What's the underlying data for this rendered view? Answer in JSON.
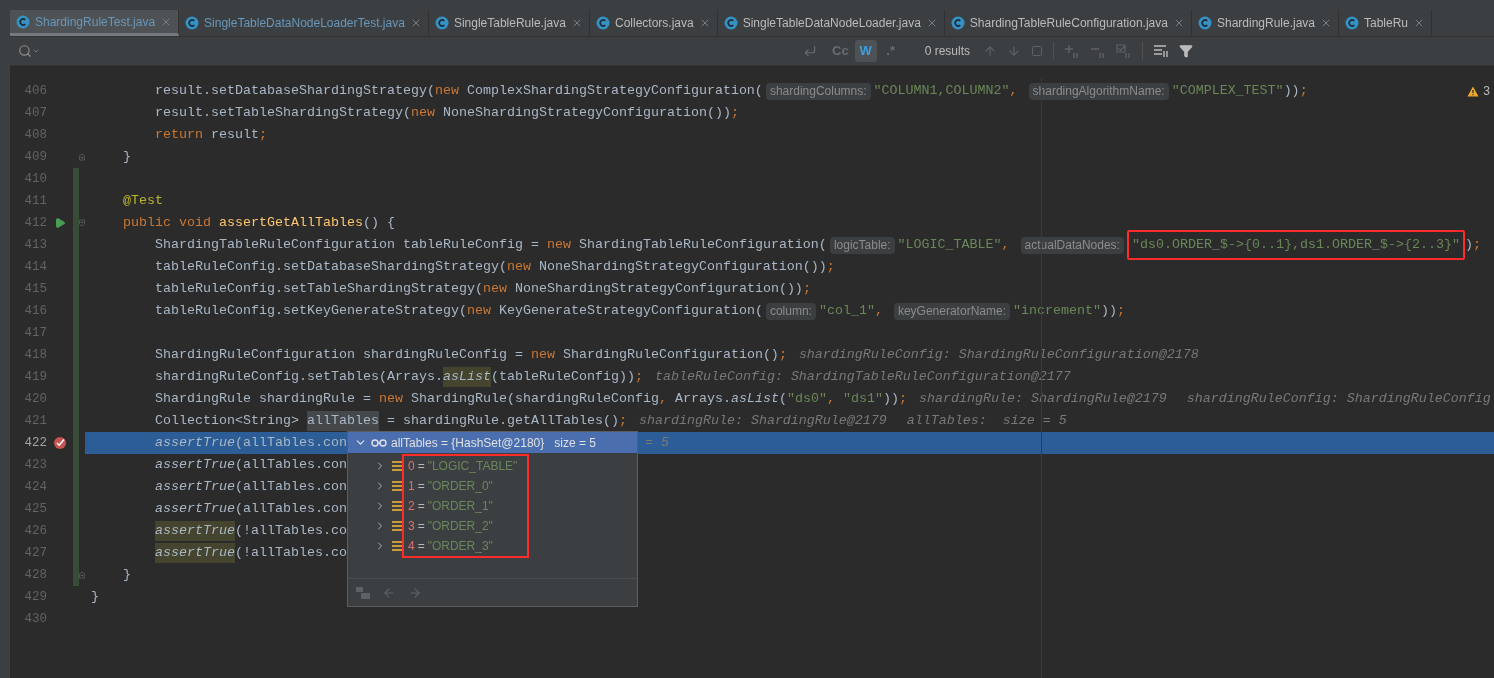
{
  "tabs": [
    {
      "label": "ShardingRuleTest.java",
      "selected": true,
      "changed": true
    },
    {
      "label": "SingleTableDataNodeLoaderTest.java",
      "selected": false,
      "changed": true
    },
    {
      "label": "SingleTableRule.java",
      "selected": false,
      "changed": false
    },
    {
      "label": "Collectors.java",
      "selected": false,
      "changed": false
    },
    {
      "label": "SingleTableDataNodeLoader.java",
      "selected": false,
      "changed": false
    },
    {
      "label": "ShardingTableRuleConfiguration.java",
      "selected": false,
      "changed": false
    },
    {
      "label": "ShardingRule.java",
      "selected": false,
      "changed": false
    },
    {
      "label": "TableRu",
      "selected": false,
      "changed": false
    }
  ],
  "search": {
    "toggles": [
      {
        "label": "Cc",
        "selected": false
      },
      {
        "label": "W",
        "selected": true
      },
      {
        "label": ".*",
        "selected": false
      }
    ],
    "results": "0 results"
  },
  "warnings": "3",
  "lines": [
    {
      "number": "406",
      "tokens": [
        {
          "kind": "plain",
          "text": "        result.setDatabaseShardingStrategy("
        },
        {
          "kind": "kw",
          "text": "new"
        },
        {
          "kind": "plain",
          "text": " ComplexShardingStrategyConfiguration("
        },
        {
          "kind": "hint",
          "text": "shardingColumns:"
        },
        {
          "kind": "str",
          "text": "\"COLUMN1,COLUMN2\""
        },
        {
          "kind": "punct",
          "text": ", "
        },
        {
          "kind": "hint",
          "text": "shardingAlgorithmName:"
        },
        {
          "kind": "str",
          "text": "\"COMPLEX_TEST\""
        },
        {
          "kind": "plain",
          "text": "))"
        },
        {
          "kind": "punct",
          "text": ";"
        }
      ]
    },
    {
      "number": "407",
      "tokens": [
        {
          "kind": "plain",
          "text": "        result.setTableShardingStrategy("
        },
        {
          "kind": "kw",
          "text": "new"
        },
        {
          "kind": "plain",
          "text": " NoneShardingStrategyConfiguration())"
        },
        {
          "kind": "punct",
          "text": ";"
        }
      ]
    },
    {
      "number": "408",
      "tokens": [
        {
          "kind": "kw",
          "text": "        return"
        },
        {
          "kind": "plain",
          "text": " result"
        },
        {
          "kind": "punct",
          "text": ";"
        }
      ]
    },
    {
      "number": "409",
      "fold_end": true,
      "tokens": [
        {
          "kind": "plain",
          "text": "    }"
        }
      ]
    },
    {
      "number": "410",
      "changed": true
    },
    {
      "number": "411",
      "changed": true,
      "tokens": [
        {
          "kind": "ann",
          "text": "    @Test"
        }
      ]
    },
    {
      "number": "412",
      "changed": true,
      "run_marker": true,
      "fold_start": true,
      "tokens": [
        {
          "kind": "kw",
          "text": "    public void "
        },
        {
          "kind": "decl",
          "text": "assertGetAllTables"
        },
        {
          "kind": "plain",
          "text": "() {"
        }
      ]
    },
    {
      "number": "413",
      "changed": true,
      "tokens": [
        {
          "kind": "plain",
          "text": "        ShardingTableRuleConfiguration tableRuleConfig = "
        },
        {
          "kind": "kw",
          "text": "new"
        },
        {
          "kind": "plain",
          "text": " ShardingTableRuleConfiguration("
        },
        {
          "kind": "hint",
          "text": "logicTable:"
        },
        {
          "kind": "str",
          "text": "\"LOGIC_TABLE\""
        },
        {
          "kind": "punct",
          "text": ", "
        },
        {
          "kind": "hint",
          "text": "actualDataNodes:"
        },
        {
          "kind": "boxed",
          "text": "\"ds0.ORDER_$->{0..1},ds1.ORDER_$->{2..3}\""
        },
        {
          "kind": "plain",
          "text": ")"
        },
        {
          "kind": "punct",
          "text": ";"
        }
      ]
    },
    {
      "number": "414",
      "changed": true,
      "tokens": [
        {
          "kind": "plain",
          "text": "        tableRuleConfig.setDatabaseShardingStrategy("
        },
        {
          "kind": "kw",
          "text": "new"
        },
        {
          "kind": "plain",
          "text": " NoneShardingStrategyConfiguration())"
        },
        {
          "kind": "punct",
          "text": ";"
        }
      ]
    },
    {
      "number": "415",
      "changed": true,
      "tokens": [
        {
          "kind": "plain",
          "text": "        tableRuleConfig.setTableShardingStrategy("
        },
        {
          "kind": "kw",
          "text": "new"
        },
        {
          "kind": "plain",
          "text": " NoneShardingStrategyConfiguration())"
        },
        {
          "kind": "punct",
          "text": ";"
        }
      ]
    },
    {
      "number": "416",
      "changed": true,
      "tokens": [
        {
          "kind": "plain",
          "text": "        tableRuleConfig.setKeyGenerateStrategy("
        },
        {
          "kind": "kw",
          "text": "new"
        },
        {
          "kind": "plain",
          "text": " KeyGenerateStrategyConfiguration("
        },
        {
          "kind": "hint",
          "text": "column:"
        },
        {
          "kind": "str",
          "text": "\"col_1\""
        },
        {
          "kind": "punct",
          "text": ", "
        },
        {
          "kind": "hint",
          "text": "keyGeneratorName:"
        },
        {
          "kind": "str",
          "text": "\"increment\""
        },
        {
          "kind": "plain",
          "text": "))"
        },
        {
          "kind": "punct",
          "text": ";"
        }
      ]
    },
    {
      "number": "417",
      "changed": true
    },
    {
      "number": "418",
      "changed": true,
      "tokens": [
        {
          "kind": "plain",
          "text": "        ShardingRuleConfiguration shardingRuleConfig = "
        },
        {
          "kind": "kw",
          "text": "new"
        },
        {
          "kind": "plain",
          "text": " ShardingRuleConfiguration()"
        },
        {
          "kind": "punct",
          "text": ";"
        },
        {
          "kind": "dbg",
          "text": "shardingRuleConfig: ShardingRuleConfiguration@2178"
        }
      ]
    },
    {
      "number": "419",
      "changed": true,
      "tokens": [
        {
          "kind": "plain",
          "text": "        shardingRuleConfig.setTables(Arrays."
        },
        {
          "kind": "italic_warn",
          "text": "asList"
        },
        {
          "kind": "plain",
          "text": "(tableRuleConfig))"
        },
        {
          "kind": "punct",
          "text": ";"
        },
        {
          "kind": "dbg",
          "text": "tableRuleConfig: ShardingTableRuleConfiguration@2177"
        }
      ]
    },
    {
      "number": "420",
      "changed": true,
      "tokens": [
        {
          "kind": "plain",
          "text": "        ShardingRule shardingRule = "
        },
        {
          "kind": "kw",
          "text": "new"
        },
        {
          "kind": "plain",
          "text": " ShardingRule(shardingRuleConfig"
        },
        {
          "kind": "punct",
          "text": ","
        },
        {
          "kind": "plain",
          "text": " Arrays."
        },
        {
          "kind": "italic",
          "text": "asList"
        },
        {
          "kind": "plain",
          "text": "("
        },
        {
          "kind": "str",
          "text": "\"ds0\""
        },
        {
          "kind": "punct",
          "text": ", "
        },
        {
          "kind": "str",
          "text": "\"ds1\""
        },
        {
          "kind": "plain",
          "text": "))"
        },
        {
          "kind": "punct",
          "text": ";"
        },
        {
          "kind": "dbg",
          "text": "shardingRule: ShardingRule@2179"
        },
        {
          "kind": "dbg",
          "text": "shardingRuleConfig: ShardingRuleConfig"
        }
      ]
    },
    {
      "number": "421",
      "changed": true,
      "tokens": [
        {
          "kind": "plain",
          "text": "        Collection<String> "
        },
        {
          "kind": "hl",
          "text": "allTables"
        },
        {
          "kind": "plain",
          "text": " = shardingRule.getAllTables()"
        },
        {
          "kind": "punct",
          "text": ";"
        },
        {
          "kind": "dbg",
          "text": "shardingRule: ShardingRule@2179"
        },
        {
          "kind": "dbg",
          "text": "allTables:  size = 5"
        }
      ]
    },
    {
      "number": "422",
      "changed": true,
      "current": true,
      "breakpoint": true,
      "tokens": [
        {
          "kind": "italic",
          "text": "        assertTrue"
        },
        {
          "kind": "plain",
          "text": "(allTables.con"
        }
      ],
      "after_popup": "= 5"
    },
    {
      "number": "423",
      "changed": true,
      "tokens": [
        {
          "kind": "italic",
          "text": "        assertTrue"
        },
        {
          "kind": "plain",
          "text": "(allTables.con"
        }
      ]
    },
    {
      "number": "424",
      "changed": true,
      "tokens": [
        {
          "kind": "italic",
          "text": "        assertTrue"
        },
        {
          "kind": "plain",
          "text": "(allTables.con"
        }
      ]
    },
    {
      "number": "425",
      "changed": true,
      "tokens": [
        {
          "kind": "italic",
          "text": "        assertTrue"
        },
        {
          "kind": "plain",
          "text": "(allTables.con"
        }
      ]
    },
    {
      "number": "426",
      "changed": true,
      "tokens": [
        {
          "kind": "italic_warn",
          "text": "        assertTrue"
        },
        {
          "kind": "plain",
          "text": "(!allTables.co"
        }
      ]
    },
    {
      "number": "427",
      "changed": true,
      "tokens": [
        {
          "kind": "italic_warn",
          "text": "        assertTrue"
        },
        {
          "kind": "plain",
          "text": "(!allTables.co"
        }
      ]
    },
    {
      "number": "428",
      "changed": true,
      "fold_end": true,
      "tokens": [
        {
          "kind": "plain",
          "text": "    }"
        }
      ]
    },
    {
      "number": "429",
      "tokens": [
        {
          "kind": "plain",
          "text": "}"
        }
      ]
    },
    {
      "number": "430"
    }
  ],
  "popup": {
    "title": "allTables = {HashSet@2180}",
    "size": "size = 5",
    "expanded": true,
    "boxed": true,
    "items": [
      {
        "index": "0",
        "sign": "=",
        "value": "\"LOGIC_TABLE\"",
        "expanded": false
      },
      {
        "index": "1",
        "sign": "=",
        "value": "\"ORDER_0\"",
        "expanded": false
      },
      {
        "index": "2",
        "sign": "=",
        "value": "\"ORDER_1\"",
        "expanded": false
      },
      {
        "index": "3",
        "sign": "=",
        "value": "\"ORDER_2\"",
        "expanded": false
      },
      {
        "index": "4",
        "sign": "=",
        "value": "\"ORDER_3\"",
        "expanded": false
      }
    ]
  }
}
